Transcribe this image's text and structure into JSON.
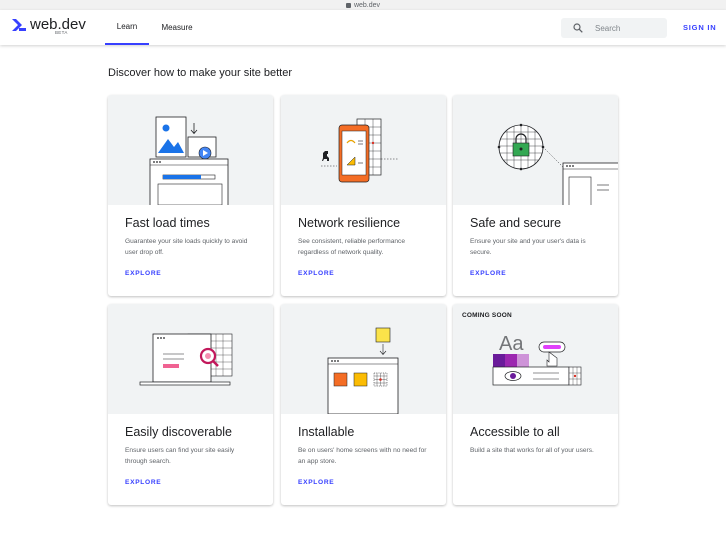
{
  "browser": {
    "url": "web.dev"
  },
  "header": {
    "logo_text": "web.dev",
    "logo_badge": "BETA",
    "tabs": [
      {
        "label": "Learn"
      },
      {
        "label": "Measure"
      }
    ],
    "search_placeholder": "Search",
    "signin_label": "SIGN IN",
    "accent_color": "#3740ff"
  },
  "main": {
    "heading": "Discover how to make your site better",
    "cards": [
      {
        "title": "Fast load times",
        "description": "Guarantee your site loads quickly to avoid user drop off.",
        "link": "EXPLORE"
      },
      {
        "title": "Network resilience",
        "description": "See consistent, reliable performance regardless of network quality.",
        "link": "EXPLORE"
      },
      {
        "title": "Safe and secure",
        "description": "Ensure your site and your user's data is secure.",
        "link": "EXPLORE"
      },
      {
        "title": "Easily discoverable",
        "description": "Ensure users can find your site easily through search.",
        "link": "EXPLORE"
      },
      {
        "title": "Installable",
        "description": "Be on users' home screens with no need for an app store.",
        "link": "EXPLORE"
      },
      {
        "title": "Accessible to all",
        "description": "Build a site that works for all of your users.",
        "badge": "COMING SOON",
        "illustration_text": "Aa"
      }
    ]
  }
}
